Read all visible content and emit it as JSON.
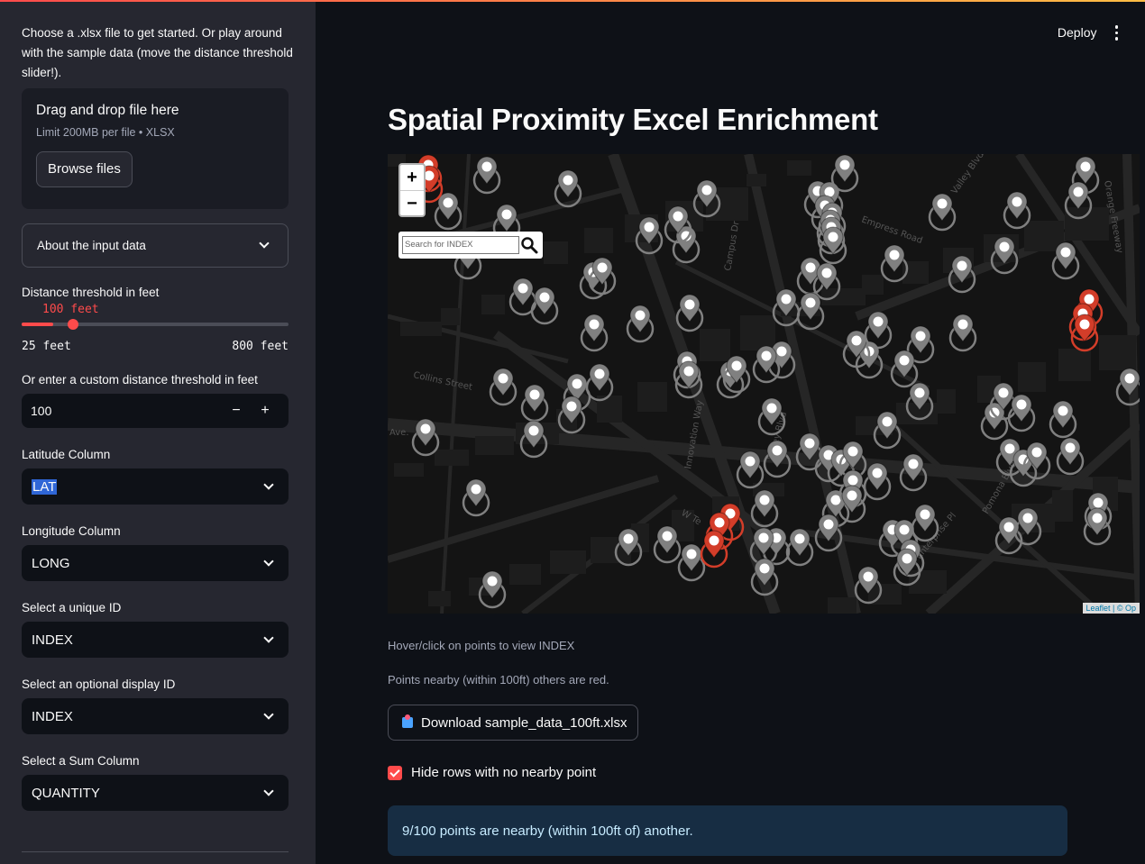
{
  "sidebar": {
    "intro": "Choose a .xlsx file to get started. Or play around with the sample data (move the distance threshold slider!).",
    "uploader": {
      "title": "Drag and drop file here",
      "limit": "Limit 200MB per file • XLSX",
      "browse_label": "Browse files"
    },
    "expander_label": "About the input data",
    "slider": {
      "label": "Distance threshold in feet",
      "value_text": "100 feet",
      "value": 100,
      "min": 25,
      "max": 800,
      "min_label": "25 feet",
      "max_label": "800 feet"
    },
    "custom_threshold": {
      "label": "Or enter a custom distance threshold in feet",
      "value": "100",
      "minus": "−",
      "plus": "+"
    },
    "selects": [
      {
        "label": "Latitude Column",
        "value": "LAT"
      },
      {
        "label": "Longitude Column",
        "value": "LONG"
      },
      {
        "label": "Select a unique ID",
        "value": "INDEX"
      },
      {
        "label": "Select an optional display ID",
        "value": "INDEX"
      },
      {
        "label": "Select a Sum Column",
        "value": "QUANTITY"
      }
    ]
  },
  "header": {
    "deploy_label": "Deploy"
  },
  "main": {
    "title": "Spatial Proximity Excel Enrichment",
    "map": {
      "zoom_in": "+",
      "zoom_out": "−",
      "search_placeholder": "Search for INDEX",
      "attribution": "Leaflet | © Op",
      "street_labels": [
        "Collins Street",
        "Ave.",
        "Valley Blvd",
        "Pomona Blvd.",
        "Innovation Way",
        "Campus Dr",
        "Enterprise Pl",
        "Orange Freeway",
        "Empress Road",
        "Valley Blvd.",
        "W Te"
      ]
    },
    "caption_hover": "Hover/click on points to view INDEX",
    "caption_nearby": "Points nearby (within 100ft) others are red.",
    "download_label": "Download sample_data_100ft.xlsx",
    "checkbox_label": "Hide rows with no nearby point",
    "checkbox_checked": true,
    "info_text": "9/100 points are nearby (within 100ft of) another.",
    "colors": {
      "accent": "#ff4b4b",
      "marker_grey": "#808080",
      "marker_red": "#d33d29",
      "info_bg": "#172d43"
    }
  }
}
